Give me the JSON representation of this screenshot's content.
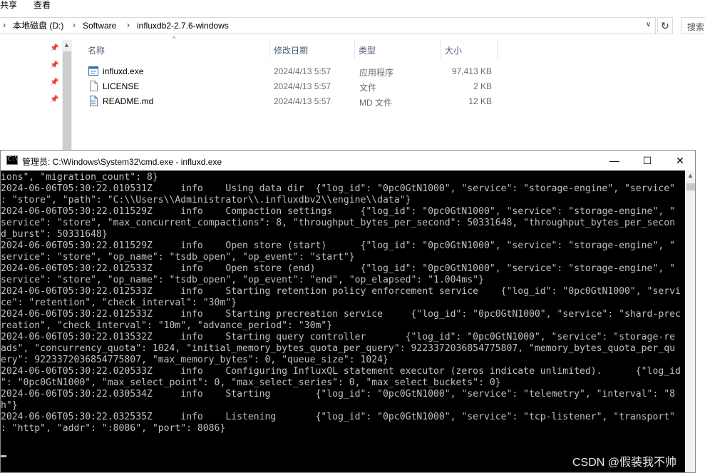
{
  "ribbon": {
    "share_tab": "共享",
    "view_tab": "查看"
  },
  "address": {
    "crumbs": [
      "本地磁盘 (D:)",
      "Software",
      "influxdb2-2.7.6-windows"
    ],
    "search_placeholder": "搜索"
  },
  "columns": {
    "name": "名称",
    "date": "修改日期",
    "type": "类型",
    "size": "大小"
  },
  "files": [
    {
      "name": "influxd.exe",
      "date": "2024/4/13 5:57",
      "type": "应用程序",
      "size": "97,413 KB"
    },
    {
      "name": "LICENSE",
      "date": "2024/4/13 5:57",
      "type": "文件",
      "size": "2 KB"
    },
    {
      "name": "README.md",
      "date": "2024/4/13 5:57",
      "type": "MD 文件",
      "size": "12 KB"
    }
  ],
  "cmd": {
    "title": "管理员: C:\\Windows\\System32\\cmd.exe - influxd.exe",
    "icon_text": "C:\\",
    "lines": [
      "ions\", \"migration_count\": 8}",
      "2024-06-06T05:30:22.010531Z     info    Using data dir  {\"log_id\": \"0pc0GtN1000\", \"service\": \"storage-engine\", \"service\"",
      ": \"store\", \"path\": \"C:\\\\Users\\\\Administrator\\\\.influxdbv2\\\\engine\\\\data\"}",
      "2024-06-06T05:30:22.011529Z     info    Compaction settings     {\"log_id\": \"0pc0GtN1000\", \"service\": \"storage-engine\", \"",
      "service\": \"store\", \"max_concurrent_compactions\": 8, \"throughput_bytes_per_second\": 50331648, \"throughput_bytes_per_secon",
      "d_burst\": 50331648}",
      "2024-06-06T05:30:22.011529Z     info    Open store (start)      {\"log_id\": \"0pc0GtN1000\", \"service\": \"storage-engine\", \"",
      "service\": \"store\", \"op_name\": \"tsdb_open\", \"op_event\": \"start\"}",
      "2024-06-06T05:30:22.012533Z     info    Open store (end)        {\"log_id\": \"0pc0GtN1000\", \"service\": \"storage-engine\", \"",
      "service\": \"store\", \"op_name\": \"tsdb_open\", \"op_event\": \"end\", \"op_elapsed\": \"1.004ms\"}",
      "2024-06-06T05:30:22.012533Z     info    Starting retention policy enforcement service    {\"log_id\": \"0pc0GtN1000\", \"servi",
      "ce\": \"retention\", \"check_interval\": \"30m\"}",
      "2024-06-06T05:30:22.012533Z     info    Starting precreation service     {\"log_id\": \"0pc0GtN1000\", \"service\": \"shard-prec",
      "reation\", \"check_interval\": \"10m\", \"advance_period\": \"30m\"}",
      "2024-06-06T05:30:22.013532Z     info    Starting query controller       {\"log_id\": \"0pc0GtN1000\", \"service\": \"storage-re",
      "ads\", \"concurrency_quota\": 1024, \"initial_memory_bytes_quota_per_query\": 9223372036854775807, \"memory_bytes_quota_per_qu",
      "ery\": 9223372036854775807, \"max_memory_bytes\": 0, \"queue_size\": 1024}",
      "2024-06-06T05:30:22.020533Z     info    Configuring InfluxQL statement executor (zeros indicate unlimited).      {\"log_id",
      "\": \"0pc0GtN1000\", \"max_select_point\": 0, \"max_select_series\": 0, \"max_select_buckets\": 0}",
      "2024-06-06T05:30:22.030534Z     info    Starting        {\"log_id\": \"0pc0GtN1000\", \"service\": \"telemetry\", \"interval\": \"8",
      "h\"}",
      "2024-06-06T05:30:22.032535Z     info    Listening       {\"log_id\": \"0pc0GtN1000\", \"service\": \"tcp-listener\", \"transport\"",
      ": \"http\", \"addr\": \":8086\", \"port\": 8086}",
      ""
    ]
  },
  "watermark": "CSDN @假装我不帅"
}
